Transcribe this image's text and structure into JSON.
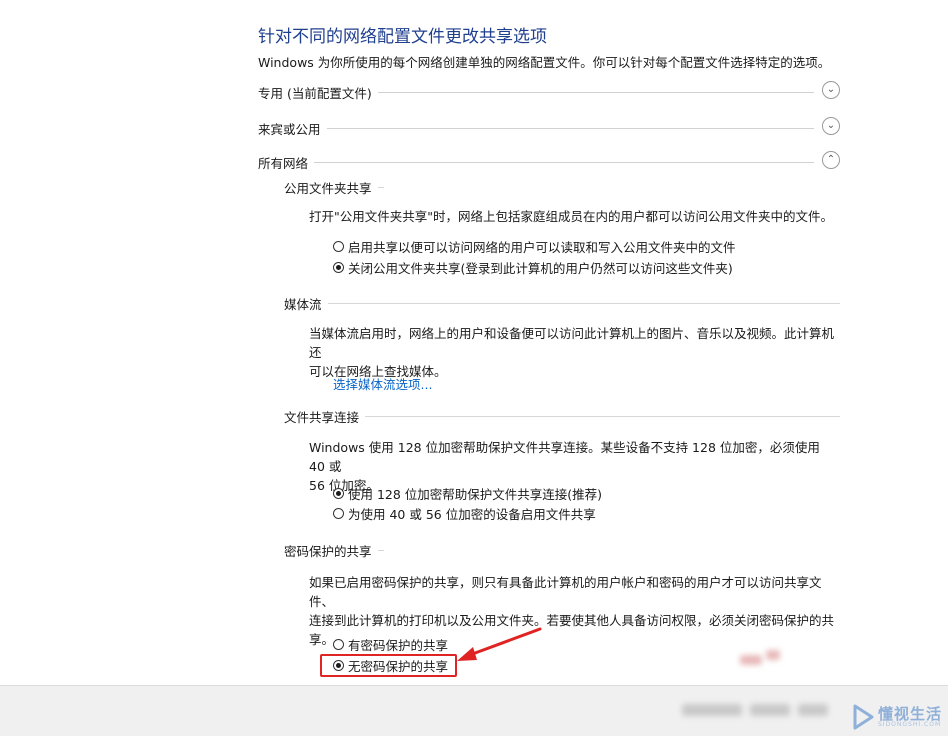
{
  "page": {
    "title": "针对不同的网络配置文件更改共享选项",
    "description": "Windows 为你所使用的每个网络创建单独的网络配置文件。你可以针对每个配置文件选择特定的选项。"
  },
  "profiles": [
    {
      "label": "专用 (当前配置文件)",
      "expanded": false
    },
    {
      "label": "来宾或公用",
      "expanded": false
    },
    {
      "label": "所有网络",
      "expanded": true
    }
  ],
  "all_networks": {
    "public_folder": {
      "heading": "公用文件夹共享",
      "text": "打开\"公用文件夹共享\"时，网络上包括家庭组成员在内的用户都可以访问公用文件夹中的文件。",
      "options": [
        {
          "label": "启用共享以便可以访问网络的用户可以读取和写入公用文件夹中的文件",
          "selected": false
        },
        {
          "label": "关闭公用文件夹共享(登录到此计算机的用户仍然可以访问这些文件夹)",
          "selected": true
        }
      ]
    },
    "media": {
      "heading": "媒体流",
      "text_line1": "当媒体流启用时，网络上的用户和设备便可以访问此计算机上的图片、音乐以及视频。此计算机还",
      "text_line2": "可以在网络上查找媒体。",
      "link": "选择媒体流选项..."
    },
    "file_sharing": {
      "heading": "文件共享连接",
      "text_line1": "Windows 使用 128 位加密帮助保护文件共享连接。某些设备不支持 128 位加密，必须使用 40 或",
      "text_line2": "56 位加密。",
      "options": [
        {
          "label": "使用 128 位加密帮助保护文件共享连接(推荐)",
          "selected": true
        },
        {
          "label": "为使用 40 或 56 位加密的设备启用文件共享",
          "selected": false
        }
      ]
    },
    "password": {
      "heading": "密码保护的共享",
      "text_line1": "如果已启用密码保护的共享，则只有具备此计算机的用户帐户和密码的用户才可以访问共享文件、",
      "text_line2": "连接到此计算机的打印机以及公用文件夹。若要使其他人具备访问权限，必须关闭密码保护的共",
      "text_line3": "享。",
      "options": [
        {
          "label": "有密码保护的共享",
          "selected": false
        },
        {
          "label": "无密码保护的共享",
          "selected": true
        }
      ]
    }
  },
  "watermark": {
    "cn": "懂视生活",
    "en": "SIDONGSHI.COM"
  },
  "colors": {
    "title": "#1f3f8f",
    "link": "#0a64c8",
    "highlight": "#e02424"
  }
}
